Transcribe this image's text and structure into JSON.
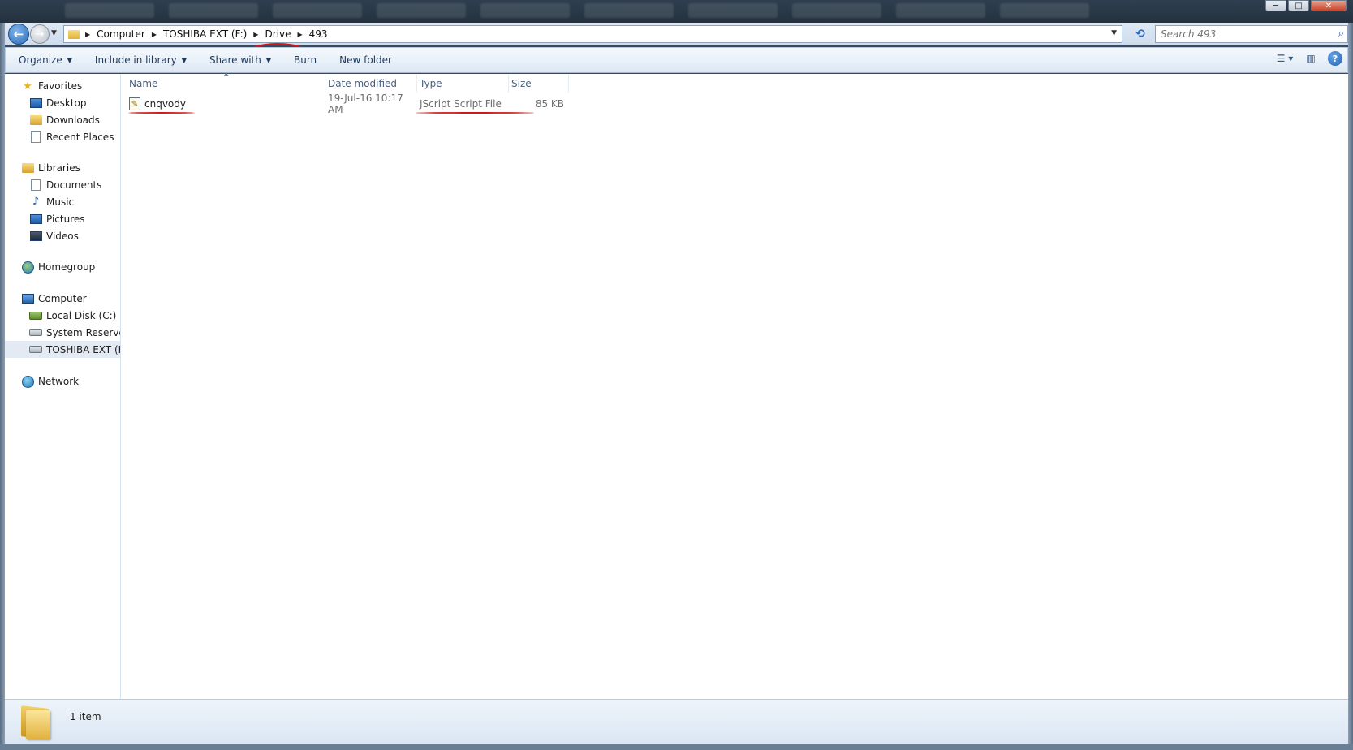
{
  "window": {
    "controls": {
      "minimize": "─",
      "maximize": "□",
      "close": "✕"
    }
  },
  "address": {
    "crumbs": [
      "Computer",
      "TOSHIBA EXT (F:)",
      "Drive",
      "493"
    ],
    "search_placeholder": "Search 493"
  },
  "toolbar": {
    "organize": "Organize",
    "include_in_library": "Include in library",
    "share_with": "Share with",
    "burn": "Burn",
    "new_folder": "New folder"
  },
  "nav": {
    "favorites": {
      "label": "Favorites",
      "items": [
        "Desktop",
        "Downloads",
        "Recent Places"
      ]
    },
    "libraries": {
      "label": "Libraries",
      "items": [
        "Documents",
        "Music",
        "Pictures",
        "Videos"
      ]
    },
    "homegroup": {
      "label": "Homegroup"
    },
    "computer": {
      "label": "Computer",
      "items": [
        "Local Disk (C:)",
        "System Reserved",
        "TOSHIBA EXT (F:)"
      ]
    },
    "network": {
      "label": "Network"
    }
  },
  "columns": {
    "name": "Name",
    "date_modified": "Date modified",
    "type": "Type",
    "size": "Size"
  },
  "files": [
    {
      "name": "cnqvody",
      "date_modified": "19-Jul-16 10:17 AM",
      "type": "JScript Script File",
      "size": "85 KB"
    }
  ],
  "status": {
    "count": "1 item"
  },
  "colors": {
    "annotation": "#d01818",
    "accent": "#2a6bb6"
  }
}
